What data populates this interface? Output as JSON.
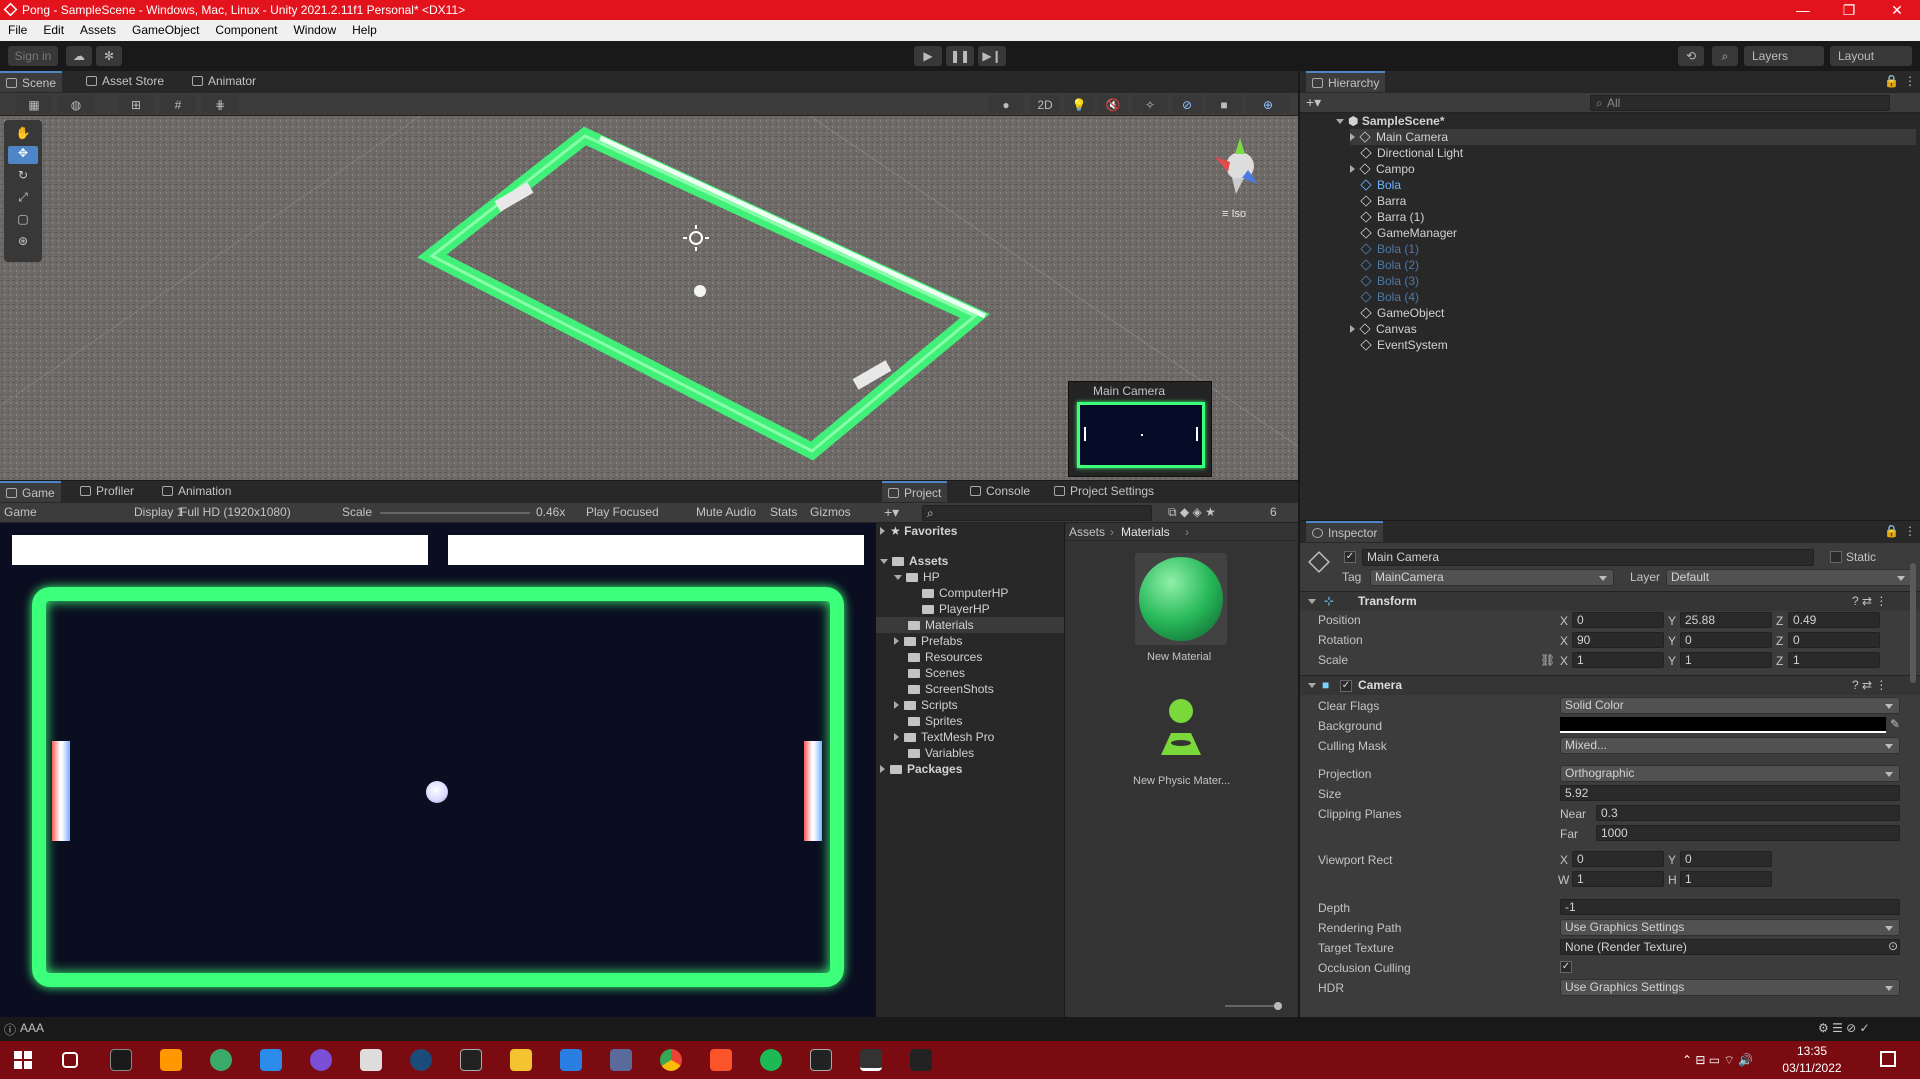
{
  "window": {
    "title": "Pong - SampleScene - Windows, Mac, Linux - Unity 2021.2.11f1 Personal* <DX11>",
    "controls": [
      "—",
      "❐",
      "✕"
    ]
  },
  "menu": [
    "File",
    "Edit",
    "Assets",
    "GameObject",
    "Component",
    "Window",
    "Help"
  ],
  "toolbar": {
    "sign_in": "Sign in",
    "layers": "Layers",
    "layout": "Layout"
  },
  "scene_tabs": [
    {
      "label": "Scene"
    },
    {
      "label": "Asset Store"
    },
    {
      "label": "Animator"
    }
  ],
  "scene": {
    "mode_2d": "2D",
    "iso": "≡ Iso",
    "preview_title": "Main Camera"
  },
  "game_tabs": [
    {
      "label": "Game"
    },
    {
      "label": "Profiler"
    },
    {
      "label": "Animation"
    }
  ],
  "game_bar": {
    "view": "Game",
    "display": "Display 1",
    "resolution": "Full HD (1920x1080)",
    "scale_label": "Scale",
    "scale_value": "0.46x",
    "play_focused": "Play Focused",
    "mute": "Mute Audio",
    "stats": "Stats",
    "gizmos": "Gizmos"
  },
  "hierarchy": {
    "title": "Hierarchy",
    "search": "All",
    "scene": "SampleScene*",
    "items": [
      "Main Camera",
      "Directional Light",
      "Campo",
      "Bola",
      "Barra",
      "Barra (1)",
      "GameManager",
      "Bola (1)",
      "Bola (2)",
      "Bola (3)",
      "Bola (4)",
      "GameObject",
      "Canvas",
      "EventSystem"
    ]
  },
  "project": {
    "tabs": [
      "Project",
      "Console",
      "Project Settings"
    ],
    "hidden_count": "6",
    "favorites": "Favorites",
    "assets": "Assets",
    "tree": [
      "HP",
      "ComputerHP",
      "PlayerHP",
      "Materials",
      "Prefabs",
      "Resources",
      "Scenes",
      "ScreenShots",
      "Scripts",
      "Sprites",
      "TextMesh Pro",
      "Variables"
    ],
    "packages": "Packages",
    "breadcrumb": [
      "Assets",
      "Materials"
    ],
    "files": [
      "New Material",
      "New Physic Mater..."
    ]
  },
  "inspector": {
    "title": "Inspector",
    "object_name": "Main Camera",
    "static": "Static",
    "tag_label": "Tag",
    "tag": "MainCamera",
    "layer_label": "Layer",
    "layer": "Default",
    "transform": {
      "title": "Transform",
      "position_label": "Position",
      "position": [
        "0",
        "25.88",
        "0.49"
      ],
      "rotation_label": "Rotation",
      "rotation": [
        "90",
        "0",
        "0"
      ],
      "scale_label": "Scale",
      "scale": [
        "1",
        "1",
        "1"
      ]
    },
    "camera": {
      "title": "Camera",
      "clear_flags_label": "Clear Flags",
      "clear_flags": "Solid Color",
      "background_label": "Background",
      "culling_label": "Culling Mask",
      "culling": "Mixed...",
      "projection_label": "Projection",
      "projection": "Orthographic",
      "size_label": "Size",
      "size": "5.92",
      "clipping_label": "Clipping Planes",
      "near_label": "Near",
      "near": "0.3",
      "far_label": "Far",
      "far": "1000",
      "viewport_label": "Viewport Rect",
      "vx": "0",
      "vy": "0",
      "vw": "1",
      "vh": "1",
      "depth_label": "Depth",
      "depth": "-1",
      "rendering_label": "Rendering Path",
      "rendering": "Use Graphics Settings",
      "target_label": "Target Texture",
      "target": "None (Render Texture)",
      "occlusion_label": "Occlusion Culling",
      "hdr_label": "HDR",
      "hdr": "Use Graphics Settings"
    }
  },
  "status": {
    "text": "AAA"
  },
  "taskbar": {
    "time": "13:35",
    "date": "03/11/2022"
  },
  "colors": {
    "accent": "#4d85c6",
    "title_red": "#e3131d",
    "neon": "#3cff7a"
  }
}
